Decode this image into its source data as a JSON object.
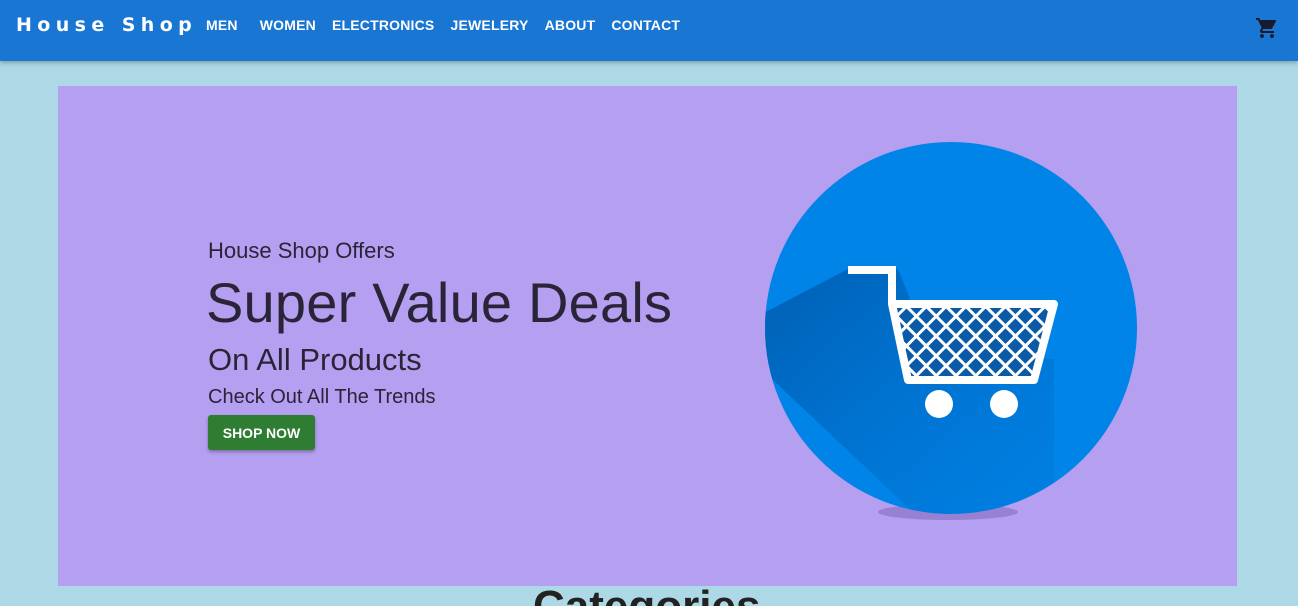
{
  "header": {
    "logo": "House Shop",
    "nav": [
      "MEN",
      "WOMEN",
      "ELECTRONICS",
      "JEWELERY",
      "ABOUT",
      "CONTACT"
    ],
    "cart_icon": "shopping-cart-icon"
  },
  "hero": {
    "offer_line": "House Shop Offers",
    "title": "Super Value Deals",
    "subtitle": "On All Products",
    "tagline": "Check Out All The Trends",
    "button_label": "SHOP NOW",
    "illustration_icon": "shopping-cart-icon"
  },
  "categories": {
    "heading": "Categories"
  },
  "colors": {
    "appbar": "#1976d2",
    "page_background": "#add8e6",
    "hero_background": "#b59ff0",
    "button": "#2e7d32",
    "circle": "#0084e8"
  }
}
